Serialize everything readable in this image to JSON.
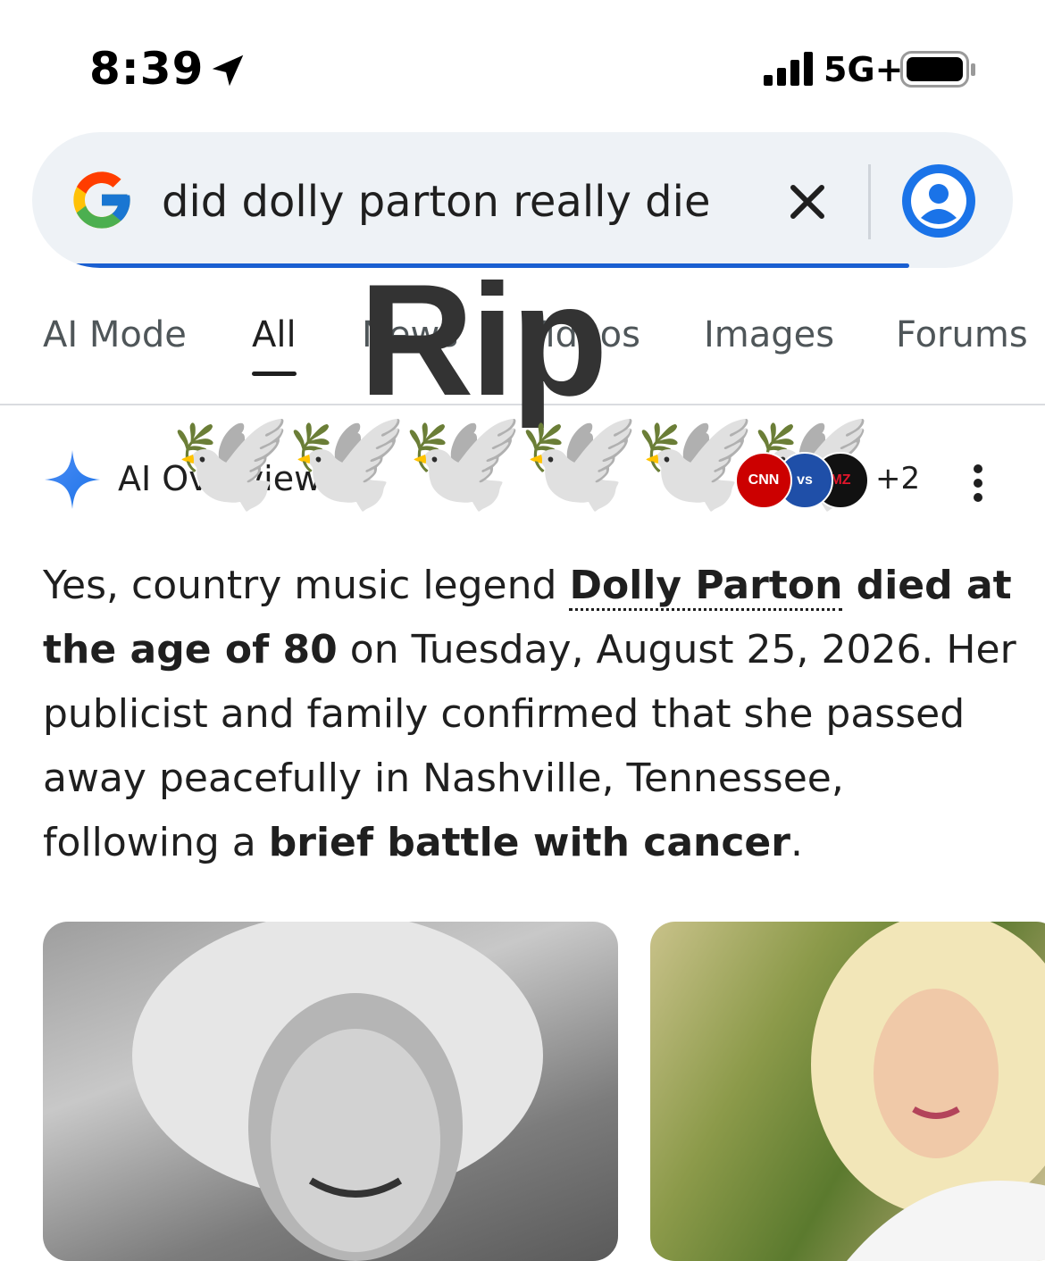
{
  "status_bar": {
    "time": "8:39",
    "network": "5G+",
    "location_icon": "location-arrow-icon",
    "signal_icon": "cellular-signal-icon",
    "battery_icon": "battery-icon"
  },
  "search": {
    "query": "did dolly parton really die",
    "logo": "google-g-logo",
    "clear_icon": "close-icon",
    "account_icon": "account-circle-icon"
  },
  "tabs": [
    {
      "label": "AI Mode",
      "active": false
    },
    {
      "label": "All",
      "active": true
    },
    {
      "label": "News",
      "active": false
    },
    {
      "label": "Videos",
      "active": false
    },
    {
      "label": "Images",
      "active": false
    },
    {
      "label": "Forums",
      "active": false
    }
  ],
  "overlay": {
    "text": "Rip",
    "dove": "🕊️",
    "dove_count": 6
  },
  "ai_overview": {
    "label": "AI Overview",
    "spark_icon": "sparkle-icon",
    "sources": [
      "CNN",
      "vs",
      "MZ"
    ],
    "more_sources": "+2",
    "menu_icon": "more-vert-icon",
    "answer": {
      "p1": "Yes, country music legend ",
      "link": "Dolly Parton",
      "b1": " died at the age of 80",
      "p2": " on Tuesday, August 25, 2026. Her publicist and family confirmed that she passed away peacefully in Nashville, Tennessee, following a ",
      "b2": "brief battle with cancer",
      "p3": "."
    }
  },
  "colors": {
    "search_bg": "#eef2f6",
    "accent_blue": "#1a73e8",
    "progress_blue": "#1a5fd1",
    "text": "#1f1f1f",
    "muted": "#4f5659"
  }
}
